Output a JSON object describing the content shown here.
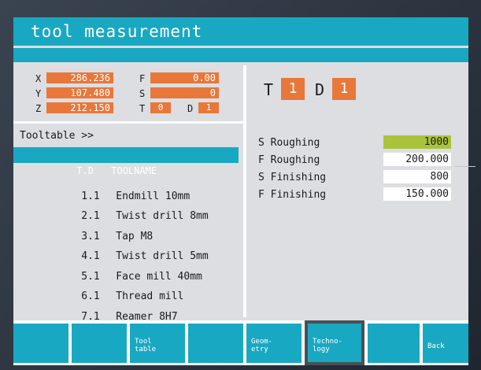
{
  "title": "tool measurement",
  "position": {
    "x": {
      "label": "X",
      "value": "286.236"
    },
    "y": {
      "label": "Y",
      "value": "107.480"
    },
    "z": {
      "label": "Z",
      "value": "212.150"
    },
    "f": {
      "label": "F",
      "value": "0.00"
    },
    "s": {
      "label": "S",
      "value": "0"
    },
    "t": {
      "label": "T",
      "value": "0"
    },
    "d": {
      "label": "D",
      "value": "1"
    }
  },
  "tooltable": {
    "header": "Tooltable >>",
    "columns": {
      "id": "T.D",
      "name": "TOOLNAME"
    },
    "rows": [
      {
        "id": "1.1",
        "name": "Endmill 10mm"
      },
      {
        "id": "2.1",
        "name": "Twist drill 8mm"
      },
      {
        "id": "3.1",
        "name": "Tap M8"
      },
      {
        "id": "4.1",
        "name": "Twist drill 5mm"
      },
      {
        "id": "5.1",
        "name": "Face mill 40mm"
      },
      {
        "id": "6.1",
        "name": "Thread mill"
      },
      {
        "id": "7.1",
        "name": "Reamer 8H7"
      }
    ]
  },
  "current_tool": {
    "t_label": "T",
    "t_value": "1",
    "d_label": "D",
    "d_value": "1"
  },
  "technology": [
    {
      "label": "S Roughing",
      "value": "1000"
    },
    {
      "label": "F Roughing",
      "value": "200.000"
    },
    {
      "label": "S Finishing",
      "value": "800"
    },
    {
      "label": "F Finishing",
      "value": "150.000"
    }
  ],
  "softkeys": [
    {
      "label": ""
    },
    {
      "label": ""
    },
    {
      "label": "Tool\ntable"
    },
    {
      "label": ""
    },
    {
      "label": "Geom-\netry"
    },
    {
      "label": "Techno-\nlogy"
    },
    {
      "label": ""
    },
    {
      "label": "Back"
    }
  ],
  "colors": {
    "accent": "#19a8c2",
    "value_box": "#e8773a",
    "active_field": "#a9c43a",
    "panel": "#dcdee2"
  }
}
